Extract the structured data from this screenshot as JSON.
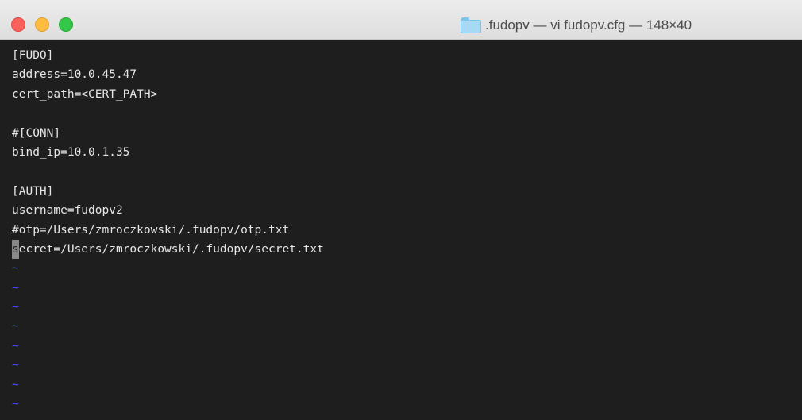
{
  "window": {
    "title": ".fudopv — vi fudopv.cfg — 148×40",
    "folder_icon": "folder-icon"
  },
  "editor": {
    "lines": [
      "[FUDO]",
      "address=10.0.45.47",
      "cert_path=<CERT_PATH>",
      "",
      "#[CONN]",
      "bind_ip=10.0.1.35",
      "",
      "[AUTH]",
      "username=fudopv2",
      "#otp=/Users/zmroczkowski/.fudopv/otp.txt"
    ],
    "cursor_line": {
      "cursor_char": "s",
      "rest": "ecret=/Users/zmroczkowski/.fudopv/secret.txt"
    },
    "empty_marker": "~",
    "colors": {
      "background": "#1e1e1e",
      "text": "#e6e6e6",
      "tilde": "#5252ff"
    }
  }
}
